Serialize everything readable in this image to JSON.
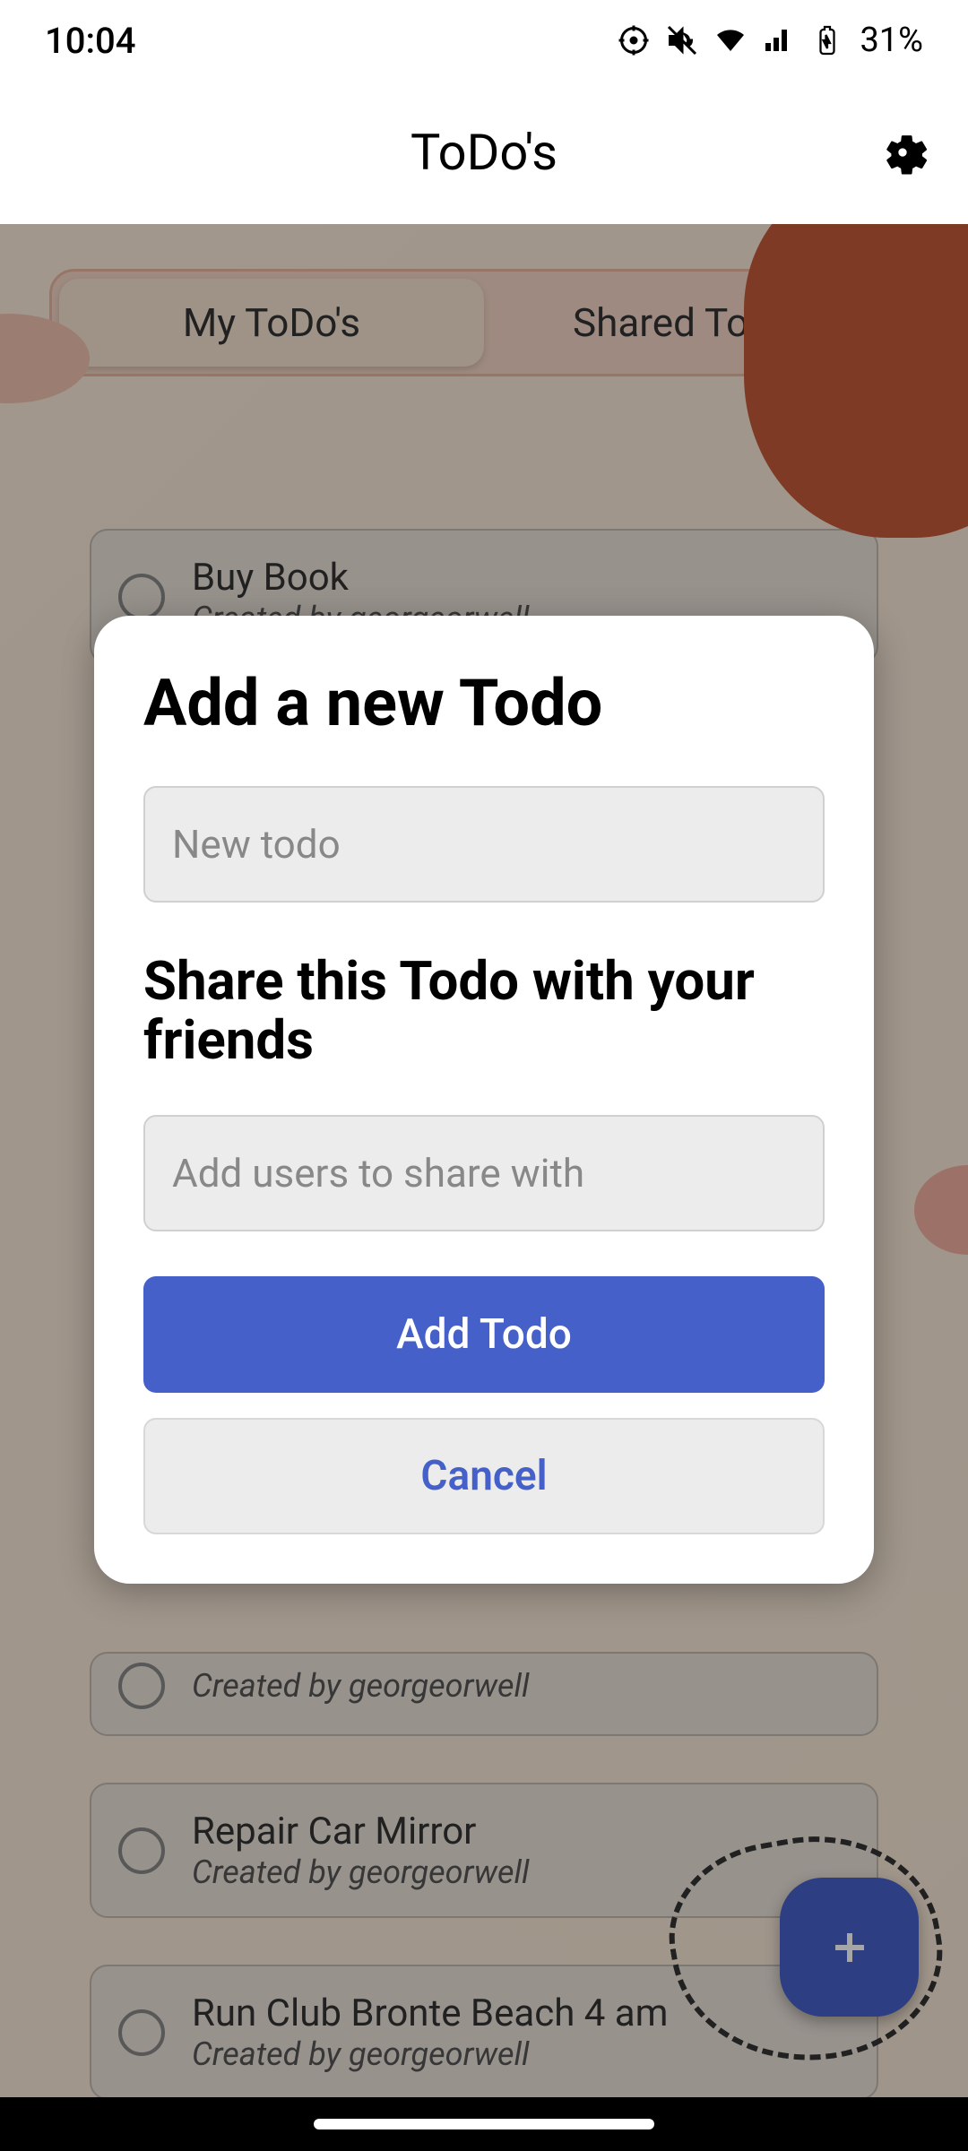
{
  "status": {
    "time": "10:04",
    "battery": "31%"
  },
  "header": {
    "title": "ToDo's"
  },
  "tabs": {
    "my": "My ToDo's",
    "shared": "Shared ToDo's"
  },
  "todos": [
    {
      "title": "Buy Book",
      "creator": "Created by georgeorwell"
    },
    {
      "title": "Repair Car Mirror",
      "creator": "Created by georgeorwell"
    },
    {
      "title": "Run Club Bronte Beach 4 am",
      "creator": "Created by georgeorwell"
    }
  ],
  "hidden_todo": {
    "creator": "Created by georgeorwell"
  },
  "modal": {
    "title": "Add a new Todo",
    "input_placeholder": "New todo",
    "share_title": "Share this Todo with your friends",
    "share_placeholder": "Add users to share with",
    "add_button": "Add Todo",
    "cancel_button": "Cancel"
  }
}
